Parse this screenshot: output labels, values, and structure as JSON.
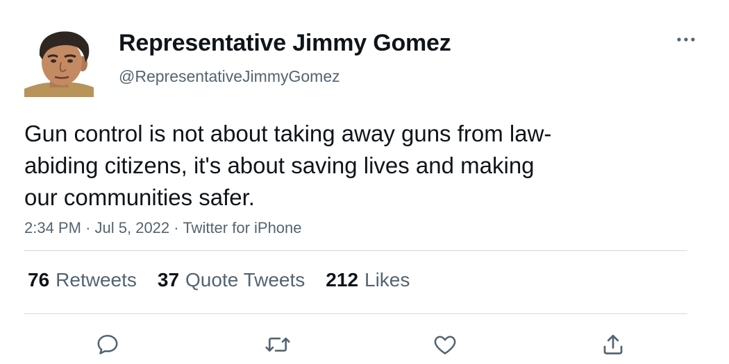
{
  "author": {
    "display_name": "Representative Jimmy Gomez",
    "handle": "@RepresentativeJimmyGomez"
  },
  "tweet": {
    "text": "Gun control is not about taking away guns from law-\nabiding citizens, it's about saving lives and making\nour communities safer.",
    "time": "2:34 PM",
    "separator": "·",
    "date": "Jul 5, 2022",
    "source": "Twitter for iPhone"
  },
  "stats": {
    "retweets": {
      "count": "76",
      "label": "Retweets"
    },
    "quote_tweets": {
      "count": "37",
      "label": "Quote Tweets"
    },
    "likes": {
      "count": "212",
      "label": "Likes"
    }
  },
  "icons": {
    "more": "more-horizontal-icon",
    "reply": "reply-icon",
    "retweet": "retweet-icon",
    "like": "heart-icon",
    "share": "share-icon"
  },
  "colors": {
    "text_primary": "#0f1419",
    "text_secondary": "#536471",
    "divider": "#cfd9de",
    "icon": "#536471"
  }
}
